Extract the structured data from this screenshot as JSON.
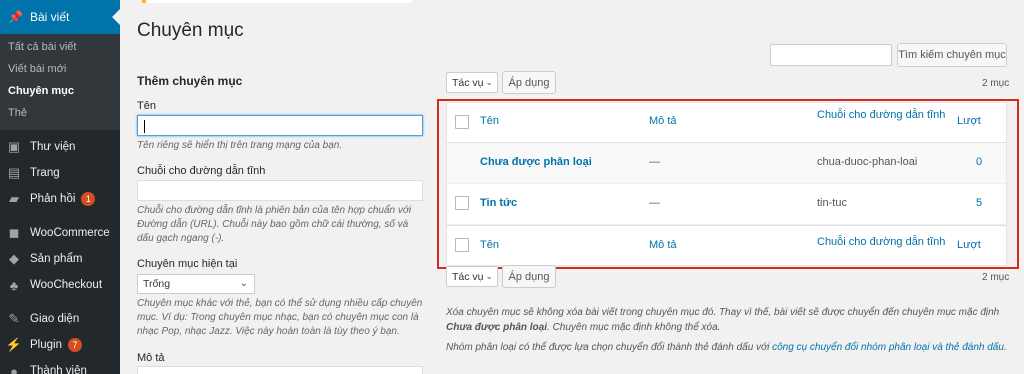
{
  "sidebar": {
    "active": {
      "label": "Bài viết",
      "icon": "pushpin-icon"
    },
    "submenu": [
      "Tất cả bài viết",
      "Viết bài mới",
      "Chuyên mục",
      "Thẻ"
    ],
    "items": [
      {
        "label": "Thư viện",
        "icon": "media-icon"
      },
      {
        "label": "Trang",
        "icon": "page-icon"
      },
      {
        "label": "Phản hồi",
        "icon": "comment-icon",
        "badge": "1"
      },
      {
        "label": "WooCommerce",
        "icon": "woocommerce-icon"
      },
      {
        "label": "Sản phẩm",
        "icon": "product-icon"
      },
      {
        "label": "WooCheckout",
        "icon": "checkout-icon"
      },
      {
        "label": "Giao diện",
        "icon": "appearance-icon"
      },
      {
        "label": "Plugin",
        "icon": "plugin-icon",
        "badge": "7"
      },
      {
        "label": "Thành viên",
        "icon": "users-icon"
      }
    ]
  },
  "page": {
    "title": "Chuyên mục"
  },
  "search": {
    "button": "Tìm kiếm chuyên mục",
    "value": ""
  },
  "form": {
    "heading": "Thêm chuyên mục",
    "name_label": "Tên",
    "name_desc": "Tên riêng sẽ hiển thị trên trang mạng của bạn.",
    "slug_label": "Chuỗi cho đường dẫn tĩnh",
    "slug_desc": "Chuỗi cho đường dẫn tĩnh là phiên bản của tên hợp chuẩn với Đường dẫn (URL). Chuỗi này bao gồm chữ cái thường, số và dấu gạch ngang (-).",
    "parent_label": "Chuyên mục hiện tại",
    "parent_value": "Trống",
    "parent_desc": "Chuyên mục khác với thẻ, bạn có thể sử dụng nhiều cấp chuyên mục. Ví dụ: Trong chuyên mục nhạc, bạn có chuyên mục con là nhạc Pop, nhạc Jazz. Việc này hoàn toàn là tùy theo ý bạn.",
    "desc_label": "Mô tả"
  },
  "bulk": {
    "select": "Tác vụ",
    "apply": "Áp dụng",
    "count": "2 mục"
  },
  "table": {
    "headers": {
      "name": "Tên",
      "desc": "Mô tả",
      "slug": "Chuỗi cho đường dẫn tĩnh",
      "count": "Lượt"
    },
    "rows": [
      {
        "name": "Chưa được phân loại",
        "desc": "—",
        "slug": "chua-duoc-phan-loai",
        "count": "0"
      },
      {
        "name": "Tin tức",
        "desc": "—",
        "slug": "tin-tuc",
        "count": "5"
      }
    ]
  },
  "help": {
    "line1_a": "Xóa chuyên mục sẽ không xóa bài viết trong chuyên mục đó. Thay vì thế, bài viết sẽ được chuyển đến chuyên mục mặc định ",
    "line1_b": "Chưa được phân loại",
    "line1_c": ". Chuyên mục mặc định không thể xóa.",
    "line2_a": "Nhóm phân loại có thể được lựa chọn chuyển đổi thành thẻ đánh dấu với ",
    "line2_link": "công cụ chuyển đổi nhóm phân loại và thẻ đánh dấu",
    "line2_c": "."
  },
  "colors": {
    "accent": "#0073aa",
    "sidebar": "#23282d",
    "highlight_box": "#d52b1e",
    "badge": "#d54e21"
  }
}
